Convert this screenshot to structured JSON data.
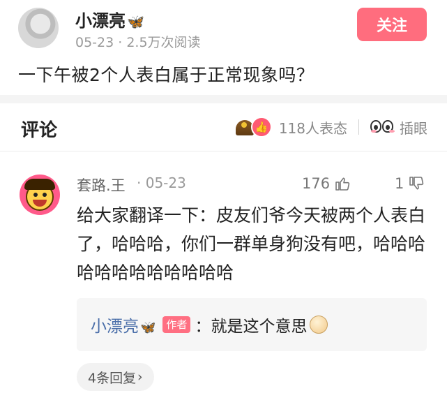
{
  "post": {
    "author": "小漂亮",
    "author_emoji": "🦋",
    "date": "05-23",
    "views": "2.5万次阅读",
    "follow_label": "关注",
    "title": "一下午被2个人表白属于正常现象吗？"
  },
  "comments_header": {
    "title": "评论",
    "reaction_count": "118人表态",
    "poke_label": "插眼"
  },
  "comment": {
    "user": "套路.王",
    "date": "05-23",
    "likes": "176",
    "dislikes": "1",
    "body": "给大家翻译一下：皮友们爷今天被两个人表白了，哈哈哈，你们一群单身狗没有吧，哈哈哈哈哈哈哈哈哈哈哈哈",
    "reply": {
      "author": "小漂亮",
      "author_emoji": "🦋",
      "tag": "作者",
      "text": "：就是这个意思"
    },
    "more_replies": "4条回复"
  },
  "colors": {
    "accent": "#ff6d7e",
    "reply_author": "#4a6ea9",
    "muted": "#999999"
  }
}
